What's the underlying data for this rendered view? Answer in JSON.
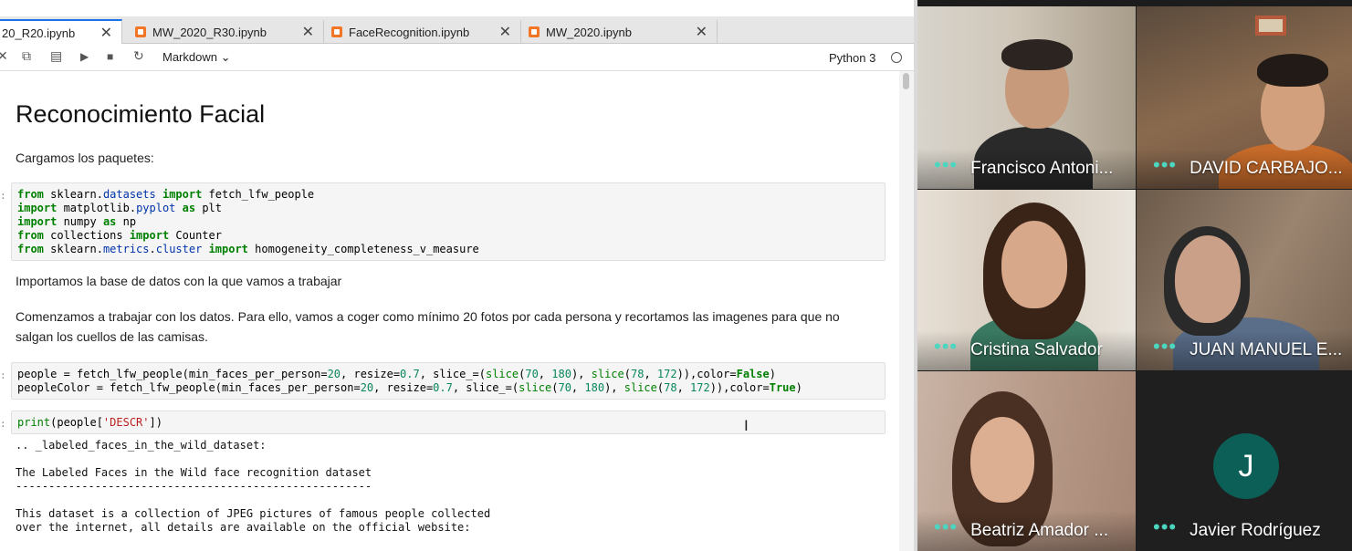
{
  "notebook": {
    "tabs": [
      {
        "label": "20_R20.ipynb",
        "active": true
      },
      {
        "label": "MW_2020_R30.ipynb",
        "active": false
      },
      {
        "label": "FaceRecognition.ipynb",
        "active": false
      },
      {
        "label": "MW_2020.ipynb",
        "active": false
      }
    ],
    "toolbar": {
      "cut_icon": "cut-icon",
      "copy_icon": "copy-icon",
      "paste_icon": "paste-icon",
      "run_icon": "play-icon",
      "stop_icon": "stop-icon",
      "restart_icon": "restart-icon",
      "cell_type": "Markdown",
      "kernel_name": "Python 3"
    },
    "heading": "Reconocimiento Facial",
    "markdown": {
      "load_packages": "Cargamos los paquetes:",
      "import_db": "Importamos la base de datos con la que vamos a trabajar",
      "start_line1": "Comenzamos a trabajar con los datos. Para ello, vamos a coger como mínimo 20 fotos por cada persona y recortamos las imagenes para que no",
      "start_line2": "salgan los cuellos de las camisas."
    },
    "cell_marker": ":",
    "code": {
      "imports": [
        "from sklearn.datasets import fetch_lfw_people",
        "import matplotlib.pyplot as plt",
        "import numpy as np",
        "from collections import Counter",
        "from sklearn.metrics.cluster import homogeneity_completeness_v_measure"
      ],
      "people": [
        "people = fetch_lfw_people(min_faces_per_person=20, resize=0.7, slice_=(slice(70, 180), slice(78, 172)),color=False)",
        "peopleColor = fetch_lfw_people(min_faces_per_person=20, resize=0.7, slice_=(slice(70, 180), slice(78, 172)),color=True)"
      ],
      "print": "print(people['DESCR'])"
    },
    "output": [
      ".. _labeled_faces_in_the_wild_dataset:",
      "",
      "The Labeled Faces in the Wild face recognition dataset",
      "------------------------------------------------------",
      "",
      "This dataset is a collection of JPEG pictures of famous people collected",
      "over the internet, all details are available on the official website:"
    ]
  },
  "participants": [
    {
      "name": "Francisco Antoni...",
      "menu_icon": "more-dots-icon"
    },
    {
      "name": "DAVID CARBAJO...",
      "menu_icon": "more-dots-icon"
    },
    {
      "name": "Cristina Salvador",
      "menu_icon": "more-dots-icon"
    },
    {
      "name": "JUAN MANUEL E...",
      "menu_icon": "more-dots-icon"
    },
    {
      "name": "Beatriz Amador ...",
      "menu_icon": "more-dots-icon"
    },
    {
      "name": "Javier Rodríguez",
      "menu_icon": "more-dots-icon",
      "avatar_initial": "J"
    }
  ],
  "colors": {
    "jupyter_orange": "#f37626",
    "avatar_green": "#0b5f56",
    "dots_teal": "#4cd6c0"
  }
}
